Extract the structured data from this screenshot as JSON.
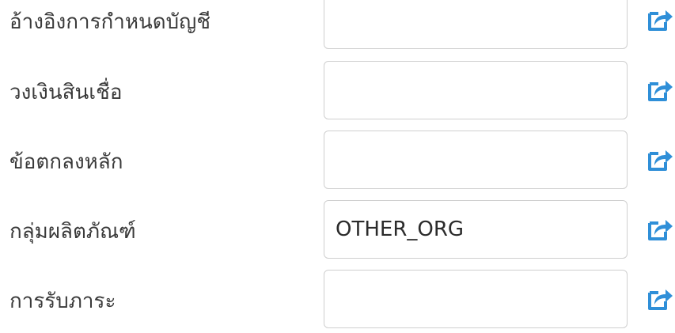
{
  "form": {
    "rows": [
      {
        "label": "อ้างอิงการกำหนดบัญชี",
        "value": "",
        "action_icon": "share-external-icon"
      },
      {
        "label": "วงเงินสินเชื่อ",
        "value": "",
        "action_icon": "share-external-icon"
      },
      {
        "label": "ข้อตกลงหลัก",
        "value": "",
        "action_icon": "share-external-icon"
      },
      {
        "label": "กลุ่มผลิตภัณฑ์",
        "value": "OTHER_ORG",
        "action_icon": "share-external-icon"
      },
      {
        "label": "การรับภาระ",
        "value": "",
        "action_icon": "share-external-icon"
      }
    ]
  },
  "colors": {
    "label_text": "#3a3a3a",
    "field_border": "#cfcfcf",
    "icon_blue": "#2f8fd8"
  }
}
